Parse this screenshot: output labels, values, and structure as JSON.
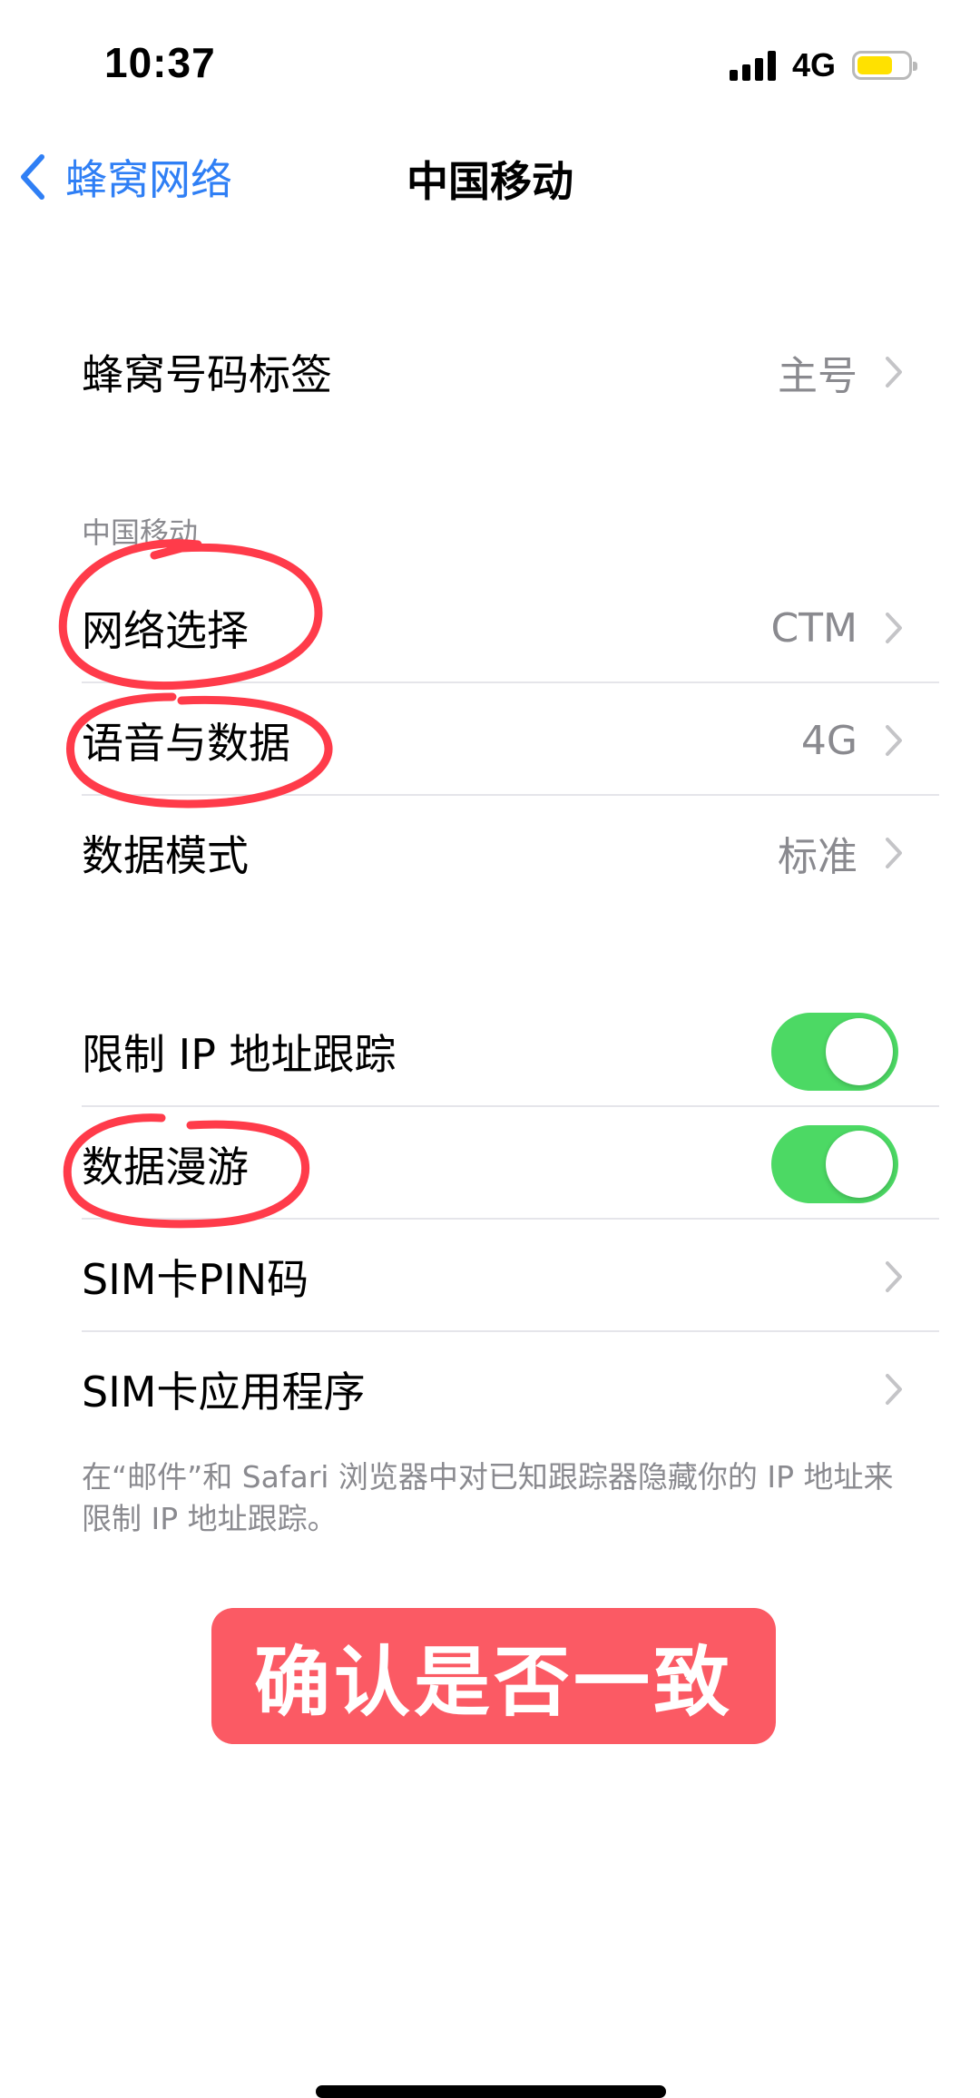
{
  "status_bar": {
    "time": "10:37",
    "network": "4G",
    "battery_color": "#ffe100"
  },
  "nav": {
    "back_label": "蜂窝网络",
    "title": "中国移动"
  },
  "rows": {
    "number_label": {
      "label": "蜂窝号码标签",
      "value": "主号"
    },
    "network_select": {
      "label": "网络选择",
      "value": "CTM"
    },
    "voice_data": {
      "label": "语音与数据",
      "value": "4G"
    },
    "data_mode": {
      "label": "数据模式",
      "value": "标准"
    },
    "limit_ip": {
      "label": "限制 IP 地址跟踪",
      "on": true
    },
    "data_roaming": {
      "label": "数据漫游",
      "on": true
    },
    "sim_pin": {
      "label": "SIM卡PIN码"
    },
    "sim_apps": {
      "label": "SIM卡应用程序"
    }
  },
  "section_header": "中国移动",
  "footer_note": "在“邮件”和 Safari 浏览器中对已知跟踪器隐藏你的 IP 地址来限制 IP 地址跟踪。",
  "badge_text": "确认是否一致",
  "colors": {
    "accent": "#2f7ff5",
    "toggle_on": "#4cd964",
    "badge": "#fb5a64",
    "annotation": "#ff3b4a"
  },
  "icons": [
    "back-chevron-icon",
    "chevron-right-icon",
    "signal-icon",
    "battery-icon"
  ]
}
